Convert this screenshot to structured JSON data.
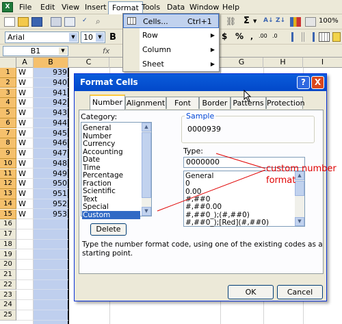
{
  "menubar": {
    "items": [
      {
        "label": "File"
      },
      {
        "label": "Edit"
      },
      {
        "label": "View"
      },
      {
        "label": "Insert"
      },
      {
        "label": "Format"
      },
      {
        "label": "Tools"
      },
      {
        "label": "Data"
      },
      {
        "label": "Window"
      },
      {
        "label": "Help"
      }
    ]
  },
  "toolbar": {
    "zoom": "100%"
  },
  "formatting": {
    "font": "Arial",
    "size": "10"
  },
  "formula_bar": {
    "name_box": "B1",
    "fx": "fx"
  },
  "grid": {
    "columns": [
      "A",
      "B",
      "C",
      "G",
      "H",
      "I"
    ],
    "rows": [
      {
        "n": "1",
        "a": "W",
        "b": "939"
      },
      {
        "n": "2",
        "a": "W",
        "b": "940"
      },
      {
        "n": "3",
        "a": "W",
        "b": "941"
      },
      {
        "n": "4",
        "a": "W",
        "b": "942"
      },
      {
        "n": "5",
        "a": "W",
        "b": "943"
      },
      {
        "n": "6",
        "a": "W",
        "b": "944"
      },
      {
        "n": "7",
        "a": "W",
        "b": "945"
      },
      {
        "n": "8",
        "a": "W",
        "b": "946"
      },
      {
        "n": "9",
        "a": "W",
        "b": "947"
      },
      {
        "n": "10",
        "a": "W",
        "b": "948"
      },
      {
        "n": "11",
        "a": "W",
        "b": "949"
      },
      {
        "n": "12",
        "a": "W",
        "b": "950"
      },
      {
        "n": "13",
        "a": "W",
        "b": "951"
      },
      {
        "n": "14",
        "a": "W",
        "b": "952"
      },
      {
        "n": "15",
        "a": "W",
        "b": "953"
      },
      {
        "n": "16",
        "a": "",
        "b": ""
      },
      {
        "n": "17",
        "a": "",
        "b": ""
      },
      {
        "n": "18",
        "a": "",
        "b": ""
      },
      {
        "n": "19",
        "a": "",
        "b": ""
      },
      {
        "n": "20",
        "a": "",
        "b": ""
      },
      {
        "n": "21",
        "a": "",
        "b": ""
      },
      {
        "n": "22",
        "a": "",
        "b": ""
      },
      {
        "n": "23",
        "a": "",
        "b": ""
      },
      {
        "n": "24",
        "a": "",
        "b": ""
      },
      {
        "n": "25",
        "a": "",
        "b": ""
      }
    ]
  },
  "format_menu": {
    "items": [
      {
        "label": "Cells...",
        "shortcut": "Ctrl+1"
      },
      {
        "label": "Row"
      },
      {
        "label": "Column"
      },
      {
        "label": "Sheet"
      }
    ]
  },
  "dialog": {
    "title": "Format Cells",
    "help": "?",
    "close": "X",
    "tabs": [
      "Number",
      "Alignment",
      "Font",
      "Border",
      "Patterns",
      "Protection"
    ],
    "category_label": "Category:",
    "categories": [
      "General",
      "Number",
      "Currency",
      "Accounting",
      "Date",
      "Time",
      "Percentage",
      "Fraction",
      "Scientific",
      "Text",
      "Special",
      "Custom"
    ],
    "selected_category": "Custom",
    "sample_label": "Sample",
    "sample_value": "0000939",
    "type_label": "Type:",
    "type_value": "0000000",
    "type_list": [
      "General",
      "0",
      "0.00",
      "#,##0",
      "#,##0.00",
      "#,##0_);(#,##0)",
      "#,##0_);[Red](#,##0)"
    ],
    "delete_label": "Delete",
    "hint": "Type the number format code, using one of the existing codes as a starting point.",
    "ok_label": "OK",
    "cancel_label": "Cancel"
  },
  "annotation": {
    "text_line1": "custom number",
    "text_line2": "format",
    "color": "#e00000"
  }
}
